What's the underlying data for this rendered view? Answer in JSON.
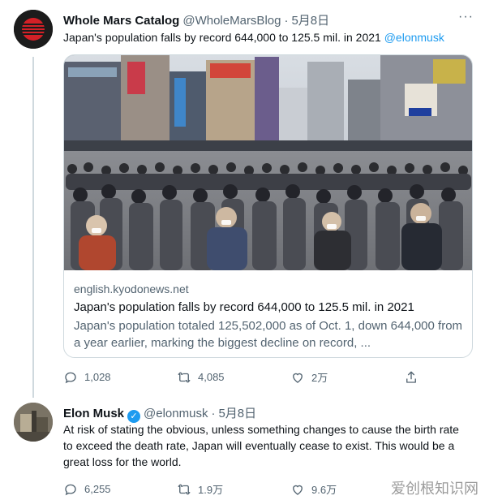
{
  "tweet1": {
    "author_name": "Whole Mars Catalog",
    "handle": "@WholeMarsBlog",
    "separator": "·",
    "date": "5月8日",
    "more": "···",
    "text": "Japan's population falls by record 644,000 to 125.5 mil. in 2021",
    "mention": "@elonmusk",
    "card": {
      "domain": "english.kyodonews.net",
      "title": "Japan's population falls by record 644,000 to 125.5 mil. in 2021",
      "description": "Japan's population totaled 125,502,000 as of Oct. 1, down 644,000 from a year earlier, marking the biggest decline on record, ..."
    },
    "actions": {
      "replies": "1,028",
      "retweets": "4,085",
      "likes": "2万"
    }
  },
  "tweet2": {
    "author_name": "Elon Musk",
    "verified_mark": "✓",
    "handle": "@elonmusk",
    "separator": "·",
    "date": "5月8日",
    "text": "At risk of stating the obvious, unless something changes to cause the birth rate to exceed the death rate, Japan will eventually cease to exist. This would be a great loss for the world.",
    "actions": {
      "replies": "6,255",
      "retweets": "1.9万",
      "likes": "9.6万"
    }
  },
  "watermark": "爱创根知识网",
  "colors": {
    "link": "#1d9bf0",
    "secondary": "#536471",
    "border": "#cfd9de",
    "verified": "#1d9bf0"
  },
  "icons": [
    "reply-icon",
    "retweet-icon",
    "like-icon",
    "share-icon",
    "verified-icon"
  ]
}
